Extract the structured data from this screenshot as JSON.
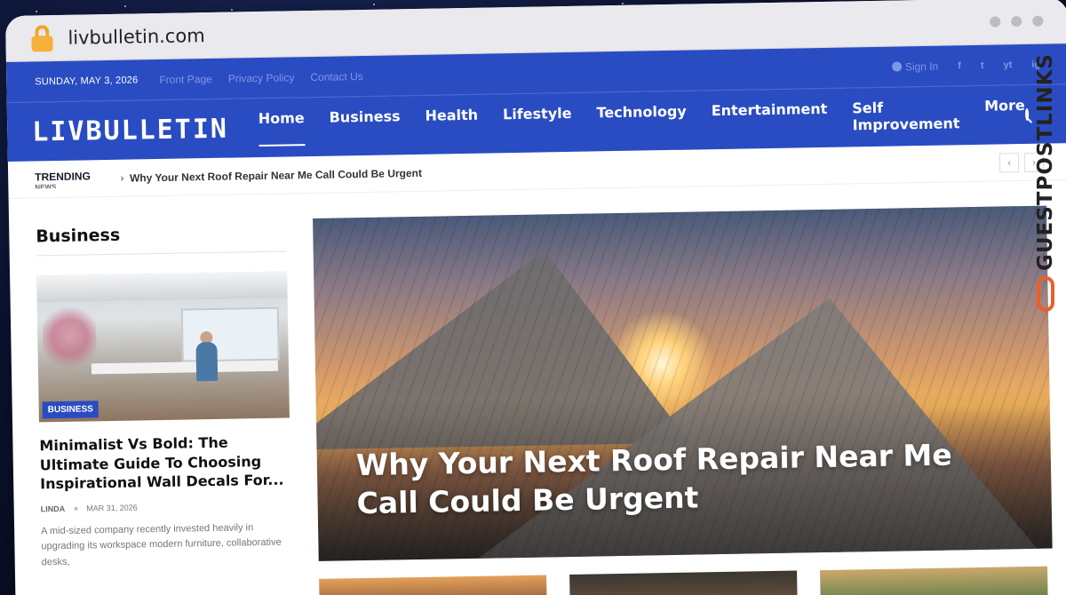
{
  "browser": {
    "url": "livbulletin.com"
  },
  "topbar": {
    "date": "SUNDAY, MAY 3, 2026",
    "links": [
      "Front Page",
      "Privacy Policy",
      "Contact Us"
    ],
    "signin": "Sign In",
    "social": [
      "f",
      "t",
      "yt",
      "ig"
    ]
  },
  "nav": {
    "logo": "LIVBULLETIN",
    "items": [
      "Home",
      "Business",
      "Health",
      "Lifestyle",
      "Technology",
      "Entertainment",
      "Self Improvement",
      "More"
    ],
    "active": "Home"
  },
  "trending": {
    "label": "TRENDING",
    "sublabel": "NEWS",
    "headline": "Why Your Next Roof Repair Near Me Call Could Be Urgent",
    "prev": "‹",
    "next": "›"
  },
  "sidebar": {
    "title": "Business",
    "card": {
      "badge": "BUSINESS",
      "title": "Minimalist Vs Bold: The Ultimate Guide To Choosing Inspirational Wall Decals For...",
      "author": "LINDA",
      "date": "MAR 31, 2026",
      "excerpt": "A mid-sized company recently invested heavily in upgrading its workspace modern furniture, collaborative desks,"
    }
  },
  "hero": {
    "title": "Why Your Next Roof Repair Near Me Call Could Be Urgent"
  },
  "watermark": {
    "text": "GUESTPOSTLINKS"
  },
  "colors": {
    "brand": "#2a4cc2",
    "accent": "#e8602c"
  }
}
